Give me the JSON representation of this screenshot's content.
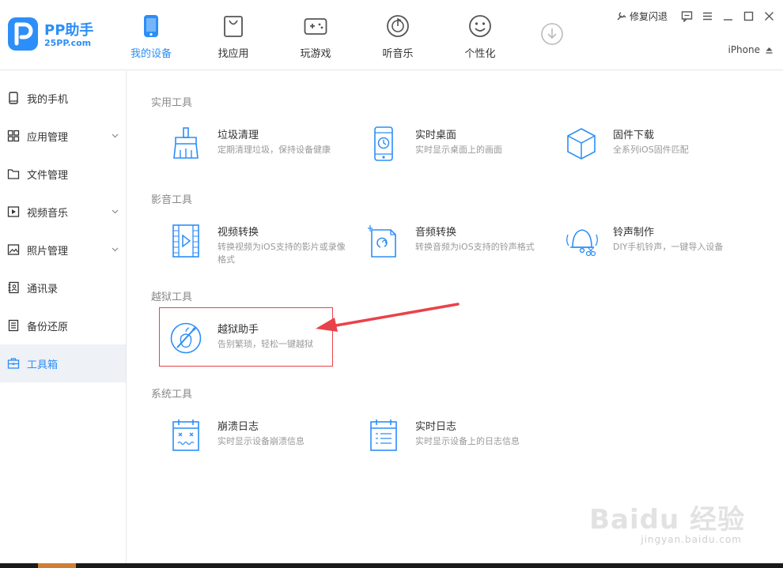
{
  "app": {
    "logo_name": "PP助手",
    "logo_sub": "25PP.com",
    "brand_color": "#2c8ef8"
  },
  "nav": [
    {
      "label": "我的设备",
      "icon": "phone-icon",
      "active": true
    },
    {
      "label": "找应用",
      "icon": "shopping-bag-icon",
      "active": false
    },
    {
      "label": "玩游戏",
      "icon": "gamepad-icon",
      "active": false
    },
    {
      "label": "听音乐",
      "icon": "music-disc-icon",
      "active": false
    },
    {
      "label": "个性化",
      "icon": "smiley-icon",
      "active": false
    },
    {
      "label": "",
      "icon": "download-icon",
      "active": false
    }
  ],
  "topbar": {
    "repair_label": "修复闪退"
  },
  "device": {
    "name": "iPhone"
  },
  "sidebar": {
    "items": [
      {
        "label": "我的手机",
        "icon": "phone-outline-icon",
        "expandable": false
      },
      {
        "label": "应用管理",
        "icon": "apps-grid-icon",
        "expandable": true
      },
      {
        "label": "文件管理",
        "icon": "folder-icon",
        "expandable": false
      },
      {
        "label": "视频音乐",
        "icon": "video-icon",
        "expandable": true
      },
      {
        "label": "照片管理",
        "icon": "photo-icon",
        "expandable": true
      },
      {
        "label": "通讯录",
        "icon": "contacts-icon",
        "expandable": false
      },
      {
        "label": "备份还原",
        "icon": "backup-icon",
        "expandable": false
      },
      {
        "label": "工具箱",
        "icon": "toolbox-icon",
        "expandable": false,
        "active": true
      }
    ]
  },
  "sections": [
    {
      "title": "实用工具",
      "tools": [
        {
          "name": "垃圾清理",
          "desc": "定期清理垃圾，保持设备健康",
          "icon": "broom-icon"
        },
        {
          "name": "实时桌面",
          "desc": "实时显示桌面上的画面",
          "icon": "live-desktop-icon"
        },
        {
          "name": "固件下载",
          "desc": "全系列iOS固件匹配",
          "icon": "firmware-cube-icon"
        }
      ]
    },
    {
      "title": "影音工具",
      "tools": [
        {
          "name": "视频转换",
          "desc": "转换视频为iOS支持的影片或录像格式",
          "icon": "video-convert-icon"
        },
        {
          "name": "音频转换",
          "desc": "转换音频为iOS支持的铃声格式",
          "icon": "audio-convert-icon"
        },
        {
          "name": "铃声制作",
          "desc": "DIY手机铃声，一键导入设备",
          "icon": "ringtone-bell-icon"
        }
      ]
    },
    {
      "title": "越狱工具",
      "tools": [
        {
          "name": "越狱助手",
          "desc": "告别繁琐，轻松一键越狱",
          "icon": "jailbreak-icon"
        }
      ]
    },
    {
      "title": "系统工具",
      "tools": [
        {
          "name": "崩溃日志",
          "desc": "实时显示设备崩溃信息",
          "icon": "crash-log-icon"
        },
        {
          "name": "实时日志",
          "desc": "实时显示设备上的日志信息",
          "icon": "live-log-icon"
        }
      ]
    }
  ],
  "watermark": {
    "main": "Baidu 经验",
    "sub": "jingyan.baidu.com"
  },
  "colors": {
    "highlight": "#e8434a",
    "icon_blue": "#2c8ef8",
    "active_bg": "#eef1f6"
  }
}
